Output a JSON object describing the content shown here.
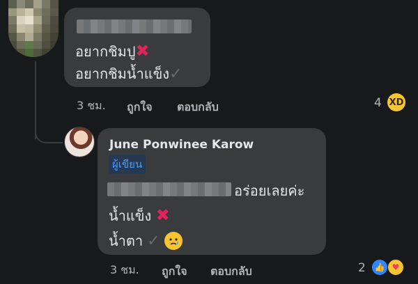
{
  "comment1": {
    "lines": [
      "อยากชิมปู",
      "อยากชิมน้ำแข็ง"
    ],
    "time": "3 ชม.",
    "like_label": "ถูกใจ",
    "reply_label": "ตอบกลับ",
    "reaction_count": "4",
    "reaction_icon": "laugh-emoji"
  },
  "reply": {
    "author": "June Ponwinee Karow",
    "badge": "ผู้เขียน",
    "lines": [
      "อร่อยเลยค่ะ",
      "น้ำแข็ง",
      "น้ำตา"
    ],
    "time": "3 ชม.",
    "like_label": "ถูกใจ",
    "reply_label": "ตอบกลับ",
    "reaction_count": "2",
    "reaction_icons": [
      "like-icon",
      "care-emoji"
    ]
  },
  "colors": {
    "background": "#18191a",
    "bubble": "#3a3b3c",
    "text": "#e4e6eb",
    "meta": "#b0b3b8",
    "badge_bg": "#263951",
    "badge_text": "#4599ff",
    "x_mark": "#e0245e",
    "like_blue": "#2d88ff"
  }
}
